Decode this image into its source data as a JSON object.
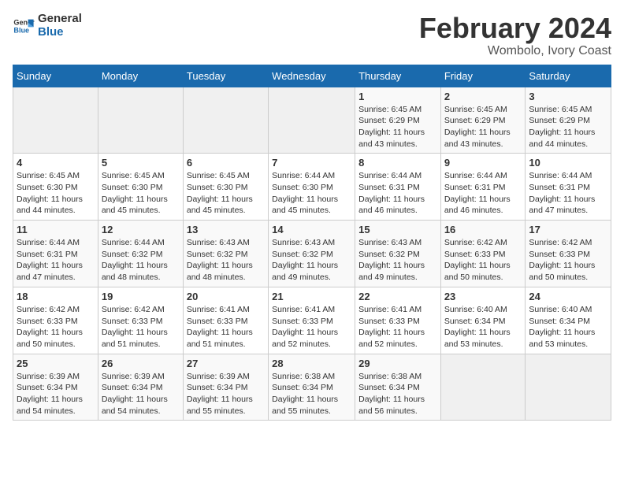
{
  "logo": {
    "line1": "General",
    "line2": "Blue"
  },
  "title": "February 2024",
  "location": "Wombolo, Ivory Coast",
  "days_of_week": [
    "Sunday",
    "Monday",
    "Tuesday",
    "Wednesday",
    "Thursday",
    "Friday",
    "Saturday"
  ],
  "weeks": [
    [
      {
        "day": "",
        "info": ""
      },
      {
        "day": "",
        "info": ""
      },
      {
        "day": "",
        "info": ""
      },
      {
        "day": "",
        "info": ""
      },
      {
        "day": "1",
        "info": "Sunrise: 6:45 AM\nSunset: 6:29 PM\nDaylight: 11 hours\nand 43 minutes."
      },
      {
        "day": "2",
        "info": "Sunrise: 6:45 AM\nSunset: 6:29 PM\nDaylight: 11 hours\nand 43 minutes."
      },
      {
        "day": "3",
        "info": "Sunrise: 6:45 AM\nSunset: 6:29 PM\nDaylight: 11 hours\nand 44 minutes."
      }
    ],
    [
      {
        "day": "4",
        "info": "Sunrise: 6:45 AM\nSunset: 6:30 PM\nDaylight: 11 hours\nand 44 minutes."
      },
      {
        "day": "5",
        "info": "Sunrise: 6:45 AM\nSunset: 6:30 PM\nDaylight: 11 hours\nand 45 minutes."
      },
      {
        "day": "6",
        "info": "Sunrise: 6:45 AM\nSunset: 6:30 PM\nDaylight: 11 hours\nand 45 minutes."
      },
      {
        "day": "7",
        "info": "Sunrise: 6:44 AM\nSunset: 6:30 PM\nDaylight: 11 hours\nand 45 minutes."
      },
      {
        "day": "8",
        "info": "Sunrise: 6:44 AM\nSunset: 6:31 PM\nDaylight: 11 hours\nand 46 minutes."
      },
      {
        "day": "9",
        "info": "Sunrise: 6:44 AM\nSunset: 6:31 PM\nDaylight: 11 hours\nand 46 minutes."
      },
      {
        "day": "10",
        "info": "Sunrise: 6:44 AM\nSunset: 6:31 PM\nDaylight: 11 hours\nand 47 minutes."
      }
    ],
    [
      {
        "day": "11",
        "info": "Sunrise: 6:44 AM\nSunset: 6:31 PM\nDaylight: 11 hours\nand 47 minutes."
      },
      {
        "day": "12",
        "info": "Sunrise: 6:44 AM\nSunset: 6:32 PM\nDaylight: 11 hours\nand 48 minutes."
      },
      {
        "day": "13",
        "info": "Sunrise: 6:43 AM\nSunset: 6:32 PM\nDaylight: 11 hours\nand 48 minutes."
      },
      {
        "day": "14",
        "info": "Sunrise: 6:43 AM\nSunset: 6:32 PM\nDaylight: 11 hours\nand 49 minutes."
      },
      {
        "day": "15",
        "info": "Sunrise: 6:43 AM\nSunset: 6:32 PM\nDaylight: 11 hours\nand 49 minutes."
      },
      {
        "day": "16",
        "info": "Sunrise: 6:42 AM\nSunset: 6:33 PM\nDaylight: 11 hours\nand 50 minutes."
      },
      {
        "day": "17",
        "info": "Sunrise: 6:42 AM\nSunset: 6:33 PM\nDaylight: 11 hours\nand 50 minutes."
      }
    ],
    [
      {
        "day": "18",
        "info": "Sunrise: 6:42 AM\nSunset: 6:33 PM\nDaylight: 11 hours\nand 50 minutes."
      },
      {
        "day": "19",
        "info": "Sunrise: 6:42 AM\nSunset: 6:33 PM\nDaylight: 11 hours\nand 51 minutes."
      },
      {
        "day": "20",
        "info": "Sunrise: 6:41 AM\nSunset: 6:33 PM\nDaylight: 11 hours\nand 51 minutes."
      },
      {
        "day": "21",
        "info": "Sunrise: 6:41 AM\nSunset: 6:33 PM\nDaylight: 11 hours\nand 52 minutes."
      },
      {
        "day": "22",
        "info": "Sunrise: 6:41 AM\nSunset: 6:33 PM\nDaylight: 11 hours\nand 52 minutes."
      },
      {
        "day": "23",
        "info": "Sunrise: 6:40 AM\nSunset: 6:34 PM\nDaylight: 11 hours\nand 53 minutes."
      },
      {
        "day": "24",
        "info": "Sunrise: 6:40 AM\nSunset: 6:34 PM\nDaylight: 11 hours\nand 53 minutes."
      }
    ],
    [
      {
        "day": "25",
        "info": "Sunrise: 6:39 AM\nSunset: 6:34 PM\nDaylight: 11 hours\nand 54 minutes."
      },
      {
        "day": "26",
        "info": "Sunrise: 6:39 AM\nSunset: 6:34 PM\nDaylight: 11 hours\nand 54 minutes."
      },
      {
        "day": "27",
        "info": "Sunrise: 6:39 AM\nSunset: 6:34 PM\nDaylight: 11 hours\nand 55 minutes."
      },
      {
        "day": "28",
        "info": "Sunrise: 6:38 AM\nSunset: 6:34 PM\nDaylight: 11 hours\nand 55 minutes."
      },
      {
        "day": "29",
        "info": "Sunrise: 6:38 AM\nSunset: 6:34 PM\nDaylight: 11 hours\nand 56 minutes."
      },
      {
        "day": "",
        "info": ""
      },
      {
        "day": "",
        "info": ""
      }
    ]
  ]
}
